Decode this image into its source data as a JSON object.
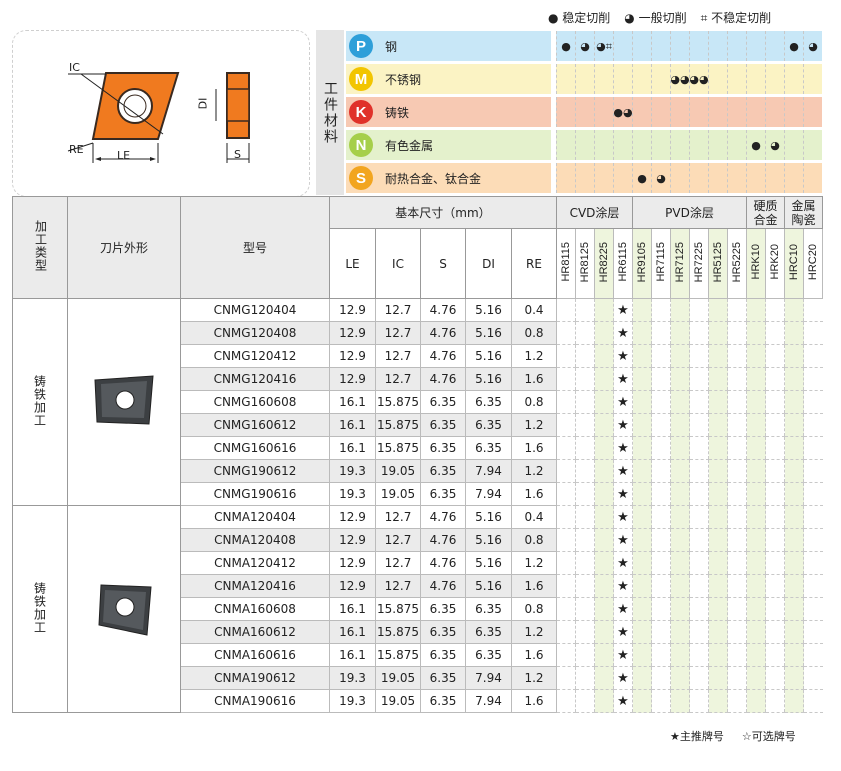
{
  "legend_top": {
    "stable": "● 稳定切削",
    "general": "◕ 一般切削",
    "unstable": "⌗ 不稳定切削"
  },
  "diagram": {
    "ic": "IC",
    "re": "RE",
    "le": "LE",
    "di": "DI",
    "s": "S"
  },
  "workpiece_label": "工件材料",
  "materials": [
    {
      "letter": "P",
      "name": "钢",
      "color": "#2e9fd9",
      "bg": "#c8e7f7"
    },
    {
      "letter": "M",
      "name": "不锈钢",
      "color": "#f2c500",
      "bg": "#fbf3c4"
    },
    {
      "letter": "K",
      "name": "铸铁",
      "color": "#e0312a",
      "bg": "#f7c9b3"
    },
    {
      "letter": "N",
      "name": "有色金属",
      "color": "#a6cf4a",
      "bg": "#e4f1cc"
    },
    {
      "letter": "S",
      "name": "耐热合金、钛合金",
      "color": "#f2a51f",
      "bg": "#fcdcb7"
    }
  ],
  "material_marks": [
    [
      "●",
      "◕",
      "◕⌗",
      "",
      "",
      "",
      "",
      "",
      "",
      "",
      "",
      "",
      "●",
      "◕"
    ],
    [
      "",
      "",
      "",
      "",
      "",
      "",
      "◕◕",
      "◕◕",
      "",
      "",
      "",
      "",
      "",
      ""
    ],
    [
      "",
      "",
      "",
      "●◕",
      "",
      "",
      "",
      "",
      "",
      "",
      "",
      "",
      "",
      ""
    ],
    [
      "",
      "",
      "",
      "",
      "",
      "",
      "",
      "",
      "",
      "",
      "●",
      "◕",
      "",
      ""
    ],
    [
      "",
      "",
      "",
      "",
      "●",
      "◕",
      "",
      "",
      "",
      "",
      "",
      "",
      "",
      ""
    ]
  ],
  "headers": {
    "process_type": "加工类型",
    "blade_shape": "刀片外形",
    "model": "型号",
    "basic_size": "基本尺寸（mm）",
    "cols": [
      "LE",
      "IC",
      "S",
      "DI",
      "RE"
    ],
    "cvd": "CVD涂层",
    "pvd": "PVD涂层",
    "hard_alloy": "硬质合金",
    "metal_ceramic": "金属陶瓷",
    "grades": [
      "HR8115",
      "HR8125",
      "HR8225",
      "HR6115",
      "HR9105",
      "HR7115",
      "HR7125",
      "HR7225",
      "HR5125",
      "HR5225",
      "HRK10",
      "HRK20",
      "HRC10",
      "HRC20"
    ]
  },
  "groups": [
    {
      "process": "铸铁加工",
      "rows": [
        [
          "CNMG120404",
          "12.9",
          "12.7",
          "4.76",
          "5.16",
          "0.4"
        ],
        [
          "CNMG120408",
          "12.9",
          "12.7",
          "4.76",
          "5.16",
          "0.8"
        ],
        [
          "CNMG120412",
          "12.9",
          "12.7",
          "4.76",
          "5.16",
          "1.2"
        ],
        [
          "CNMG120416",
          "12.9",
          "12.7",
          "4.76",
          "5.16",
          "1.6"
        ],
        [
          "CNMG160608",
          "16.1",
          "15.875",
          "6.35",
          "6.35",
          "0.8"
        ],
        [
          "CNMG160612",
          "16.1",
          "15.875",
          "6.35",
          "6.35",
          "1.2"
        ],
        [
          "CNMG160616",
          "16.1",
          "15.875",
          "6.35",
          "6.35",
          "1.6"
        ],
        [
          "CNMG190612",
          "19.3",
          "19.05",
          "6.35",
          "7.94",
          "1.2"
        ],
        [
          "CNMG190616",
          "19.3",
          "19.05",
          "6.35",
          "7.94",
          "1.6"
        ]
      ]
    },
    {
      "process": "铸铁加工",
      "rows": [
        [
          "CNMA120404",
          "12.9",
          "12.7",
          "4.76",
          "5.16",
          "0.4"
        ],
        [
          "CNMA120408",
          "12.9",
          "12.7",
          "4.76",
          "5.16",
          "0.8"
        ],
        [
          "CNMA120412",
          "12.9",
          "12.7",
          "4.76",
          "5.16",
          "1.2"
        ],
        [
          "CNMA120416",
          "12.9",
          "12.7",
          "4.76",
          "5.16",
          "1.6"
        ],
        [
          "CNMA160608",
          "16.1",
          "15.875",
          "6.35",
          "6.35",
          "0.8"
        ],
        [
          "CNMA160612",
          "16.1",
          "15.875",
          "6.35",
          "6.35",
          "1.2"
        ],
        [
          "CNMA160616",
          "16.1",
          "15.875",
          "6.35",
          "6.35",
          "1.6"
        ],
        [
          "CNMA190612",
          "19.3",
          "19.05",
          "6.35",
          "7.94",
          "1.2"
        ],
        [
          "CNMA190616",
          "19.3",
          "19.05",
          "6.35",
          "7.94",
          "1.6"
        ]
      ]
    }
  ],
  "star": "★",
  "star_grade_index": 3,
  "bottom_legend": {
    "main": "★主推牌号",
    "optional": "☆可选牌号"
  }
}
